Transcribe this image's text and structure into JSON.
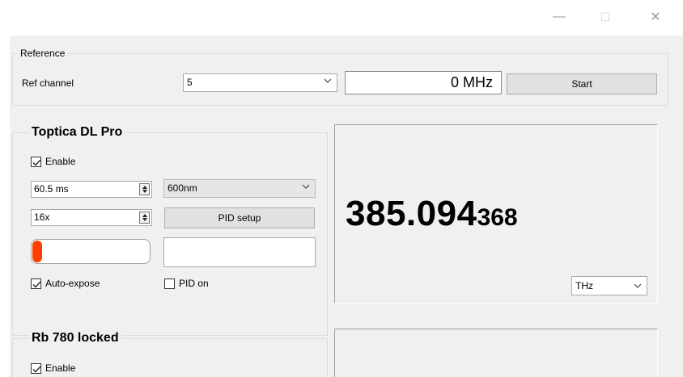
{
  "window": {
    "minimize_glyph": "—",
    "maximize_glyph": "☐",
    "close_glyph": "✕"
  },
  "reference": {
    "group_label": "Reference",
    "channel_label": "Ref channel",
    "channel_value": "5",
    "frequency_readout": "0 MHz",
    "start_label": "Start"
  },
  "toptica": {
    "title": "Toptica DL Pro",
    "enable_label": "Enable",
    "enable_checked": true,
    "exposure_value": "60.5 ms",
    "wavelength_value": "600nm",
    "gain_value": "16x",
    "pid_setup_label": "PID setup",
    "exposure_level_fraction": 0.08,
    "auto_expose_label": "Auto-expose",
    "auto_expose_checked": true,
    "pid_on_label": "PID on",
    "pid_on_checked": false,
    "frequency_major": "385.094",
    "frequency_minor": "368",
    "unit_value": "THz"
  },
  "rb780": {
    "title": "Rb 780 locked",
    "enable_label": "Enable",
    "enable_checked": true
  },
  "colors": {
    "exposure_fill": "#ff4000",
    "client_background": "#f0f0f0"
  }
}
